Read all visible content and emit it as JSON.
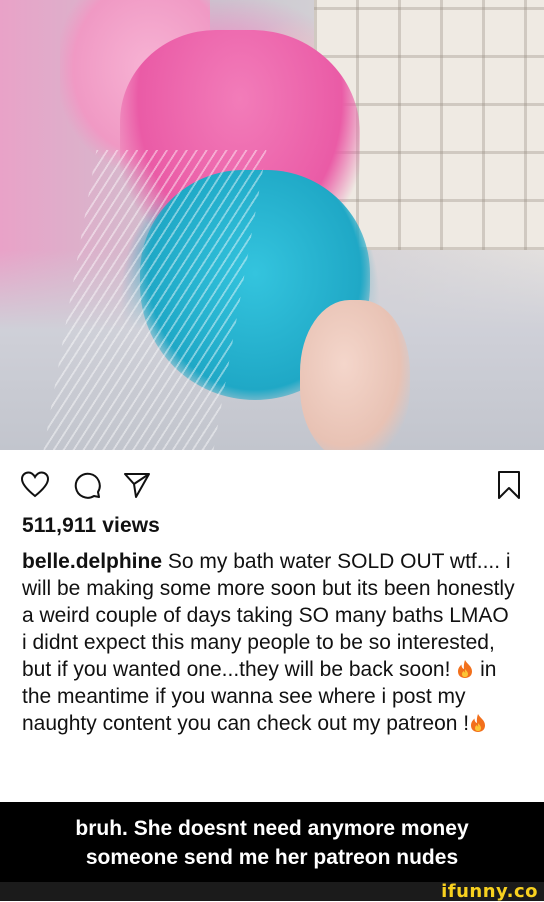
{
  "post": {
    "views": "511,911 views",
    "username": "belle.delphine",
    "caption_1": "So my bath water SOLD OUT wtf.... i will be making some more soon but its been honestly a weird couple of days taking SO many baths LMAO",
    "caption_2a": "i didnt expect this many people to be so interested, but if you wanted one...they will be back soon!",
    "caption_2b": "in the meantime if you wanna see where i post my naughty content you can check out my patreon !"
  },
  "icons": {
    "like": "heart-icon",
    "comment": "comment-icon",
    "share": "paper-plane-icon",
    "save": "bookmark-icon",
    "emoji": "fire-emoji"
  },
  "meme": {
    "line1": "bruh. She doesnt need anymore money",
    "line2": "someone send me her patreon nudes"
  },
  "watermark": {
    "text": "ifunny.co"
  },
  "colors": {
    "banner_bg": "#000000",
    "banner_text": "#ffffff",
    "watermark": "#f8d11f"
  }
}
